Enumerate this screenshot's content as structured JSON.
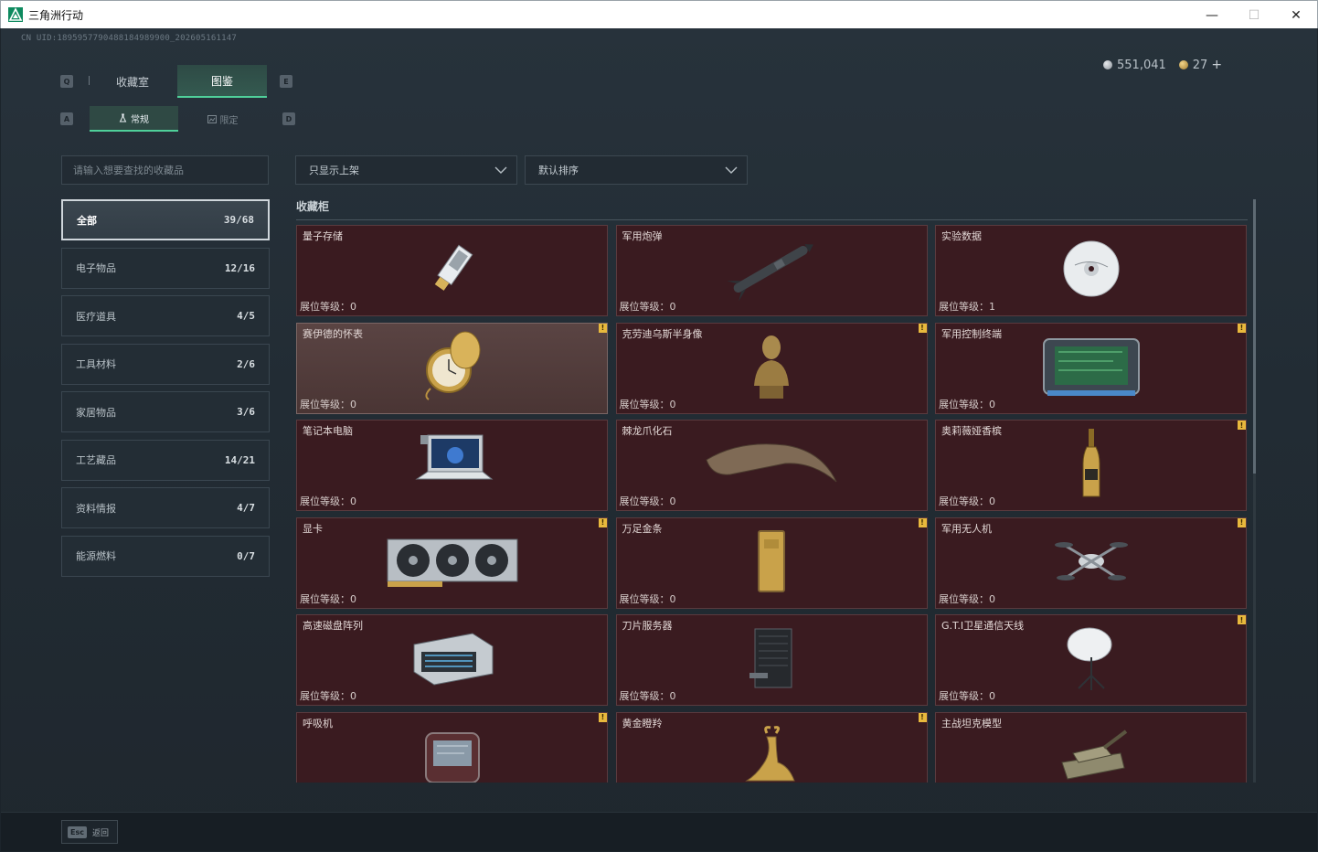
{
  "window": {
    "title": "三角洲行动",
    "minimize": "—",
    "maximize": "☐",
    "close": "✕"
  },
  "uid": "CN UID:1895957790488184989900_202605161147",
  "currency": {
    "silver": "551,041",
    "gold": "27",
    "plus": "+"
  },
  "keyhints": {
    "q": "Q",
    "e": "E",
    "a": "A",
    "d": "D"
  },
  "top_tabs": [
    {
      "label": "收藏室",
      "active": false
    },
    {
      "label": "图鉴",
      "active": true
    }
  ],
  "sub_tabs": [
    {
      "label": "常规",
      "active": true
    },
    {
      "label": "限定",
      "active": false
    }
  ],
  "search": {
    "placeholder": "请输入想要查找的收藏品"
  },
  "categories": [
    {
      "label": "全部",
      "count": "39/68",
      "active": true
    },
    {
      "label": "电子物品",
      "count": "12/16"
    },
    {
      "label": "医疗道具",
      "count": "4/5"
    },
    {
      "label": "工具材料",
      "count": "2/6"
    },
    {
      "label": "家居物品",
      "count": "3/6"
    },
    {
      "label": "工艺藏品",
      "count": "14/21"
    },
    {
      "label": "资料情报",
      "count": "4/7"
    },
    {
      "label": "能源燃料",
      "count": "0/7"
    }
  ],
  "filters": {
    "display": "只显示上架",
    "sort": "默认排序"
  },
  "section_title": "收藏柜",
  "level_label": "展位等级：",
  "alert_glyph": "!",
  "items": [
    {
      "name": "量子存储",
      "level": "0",
      "alert": false,
      "icon": "usb-drive-icon"
    },
    {
      "name": "军用炮弹",
      "level": "0",
      "alert": false,
      "icon": "missile-icon"
    },
    {
      "name": "实验数据",
      "level": "1",
      "alert": false,
      "icon": "disc-icon"
    },
    {
      "name": "赛伊德的怀表",
      "level": "0",
      "alert": true,
      "icon": "pocket-watch-icon",
      "highlight": true
    },
    {
      "name": "克劳迪乌斯半身像",
      "level": "0",
      "alert": true,
      "icon": "bust-statue-icon"
    },
    {
      "name": "军用控制终端",
      "level": "0",
      "alert": true,
      "icon": "control-terminal-icon"
    },
    {
      "name": "笔记本电脑",
      "level": "0",
      "alert": false,
      "icon": "laptop-icon"
    },
    {
      "name": "棘龙爪化石",
      "level": "0",
      "alert": false,
      "icon": "claw-fossil-icon"
    },
    {
      "name": "奥莉薇娅香槟",
      "level": "0",
      "alert": true,
      "icon": "champagne-bottle-icon"
    },
    {
      "name": "显卡",
      "level": "0",
      "alert": true,
      "icon": "graphics-card-icon"
    },
    {
      "name": "万足金条",
      "level": "0",
      "alert": true,
      "icon": "gold-bar-icon"
    },
    {
      "name": "军用无人机",
      "level": "0",
      "alert": true,
      "icon": "drone-icon"
    },
    {
      "name": "高速磁盘阵列",
      "level": "0",
      "alert": false,
      "icon": "disk-array-icon"
    },
    {
      "name": "刀片服务器",
      "level": "0",
      "alert": false,
      "icon": "blade-server-icon"
    },
    {
      "name": "G.T.I卫星通信天线",
      "level": "0",
      "alert": true,
      "icon": "satellite-dish-icon"
    },
    {
      "name": "呼吸机",
      "level": "",
      "alert": true,
      "icon": "ventilator-icon"
    },
    {
      "name": "黄金瞪羚",
      "level": "",
      "alert": true,
      "icon": "gold-gazelle-icon"
    },
    {
      "name": "主战坦克模型",
      "level": "",
      "alert": false,
      "icon": "tank-model-icon"
    }
  ],
  "footer": {
    "esc_key": "Esc",
    "esc_label": "返回"
  },
  "colors": {
    "accent": "#4fd09a",
    "card_bg": "#3a1b20",
    "alert": "#e8b93d"
  }
}
